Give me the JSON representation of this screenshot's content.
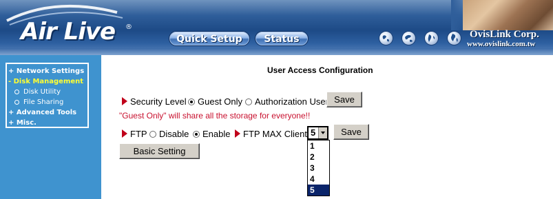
{
  "header": {
    "logo_text": "Air Live",
    "logo_mark": "®",
    "nav": [
      {
        "label": "Quick Setup"
      },
      {
        "label": "Status"
      }
    ],
    "globe_icons": [
      "globe-icon",
      "globe-icon",
      "globe-icon",
      "globe-icon"
    ],
    "company": "OvisLink Corp.",
    "website": "www.ovislink.com.tw"
  },
  "sidebar": {
    "items": [
      {
        "label": "+ Network Settings"
      },
      {
        "label": "- Disk Management"
      },
      {
        "label": "Disk Utility"
      },
      {
        "label": "File Sharing"
      },
      {
        "label": "+ Advanced Tools"
      },
      {
        "label": "+ Misc."
      }
    ]
  },
  "main": {
    "title": "User Access Configuration",
    "security": {
      "label": "Security Level",
      "options": [
        "Guest Only",
        "Authorization User"
      ],
      "selected": "Guest Only",
      "save_label": "Save"
    },
    "warning": "\"Guest Only\" will share all the storage for everyone!!",
    "ftp": {
      "label": "FTP",
      "options": [
        "Disable",
        "Enable"
      ],
      "selected": "Enable",
      "max_clients_label": "FTP MAX Clients",
      "max_clients_value": "5",
      "max_clients_options": [
        "1",
        "2",
        "3",
        "4",
        "5"
      ],
      "save_label": "Save"
    },
    "basic_setting_label": "Basic Setting"
  },
  "colors": {
    "sidebar_bg": "#3f93cf",
    "active_menu": "#ffff33",
    "warning": "#c8102e",
    "arrow": "#c0001a",
    "selected_option": "#0a246a"
  }
}
